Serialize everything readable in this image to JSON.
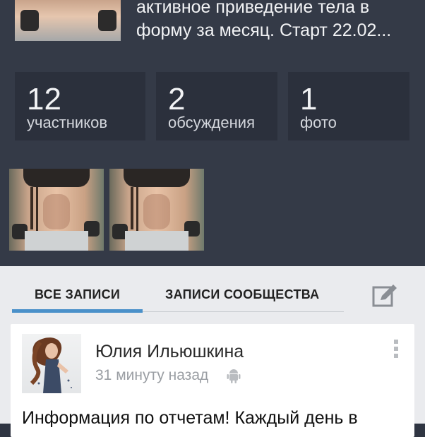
{
  "group": {
    "description_line1": "активное приведение тела в",
    "description_line2": "форму за месяц. Старт 22.02..."
  },
  "stats": [
    {
      "value": "12",
      "label": "участников"
    },
    {
      "value": "2",
      "label": "обсуждения"
    },
    {
      "value": "1",
      "label": "фото"
    }
  ],
  "tabs": {
    "all_posts": "ВСЕ ЗАПИСИ",
    "community_posts": "ЗАПИСИ СООБЩЕСТВА",
    "active": "all_posts"
  },
  "post": {
    "author": "Юлия Ильюшкина",
    "time": "31 минуту назад",
    "text": "Информация по отчетам! Каждый день в"
  },
  "icons": {
    "compose": "compose-icon",
    "android": "android-icon",
    "more": "more-vert-icon"
  },
  "colors": {
    "header_bg": "#343a47",
    "stat_tile_bg": "#2b303c",
    "tab_accent": "#4a90c9",
    "feed_bg": "#eaebee"
  }
}
